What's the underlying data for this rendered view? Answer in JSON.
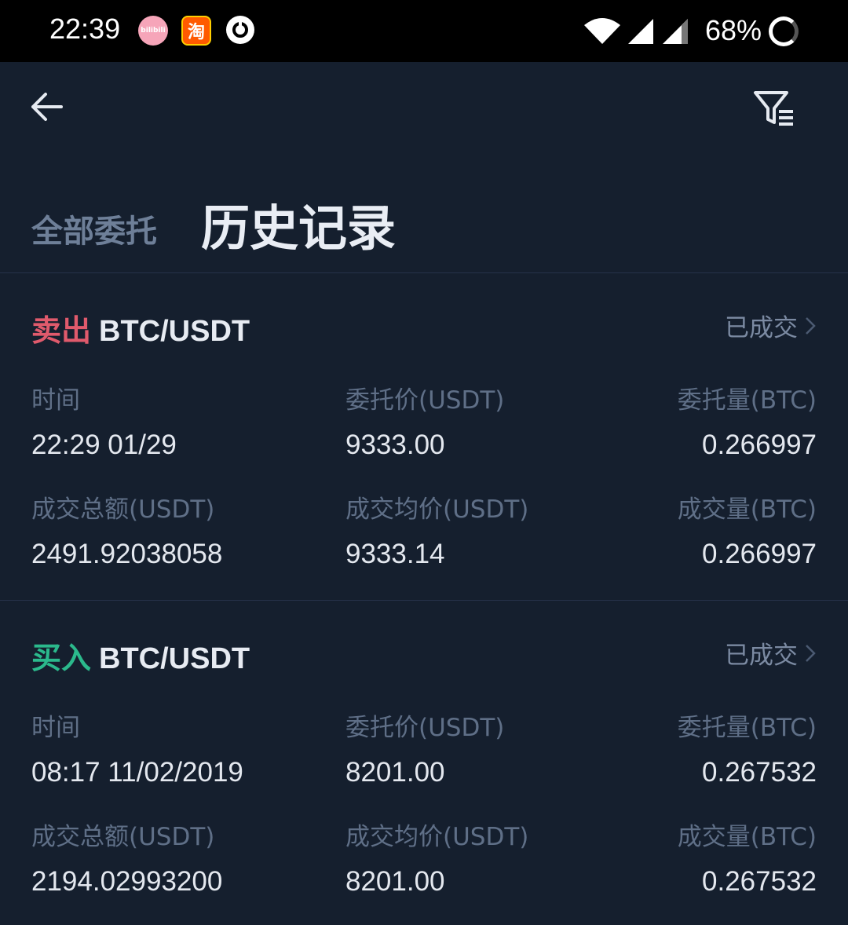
{
  "status_bar": {
    "time": "22:39",
    "battery": "68%",
    "apps": [
      "bilibili",
      "淘"
    ]
  },
  "header": {
    "back_icon": "arrow-left-icon",
    "filter_icon": "filter-icon"
  },
  "tabs": [
    {
      "label": "全部委托",
      "active": false
    },
    {
      "label": "历史记录",
      "active": true
    }
  ],
  "orders": [
    {
      "side": "卖出",
      "pair": "BTC/USDT",
      "status": "已成交",
      "side_color": "#e05a6c",
      "labels": [
        "时间",
        "委托价(USDT)",
        "委托量(BTC)",
        "成交总额(USDT)",
        "成交均价(USDT)",
        "成交量(BTC)"
      ],
      "values": [
        "22:29 01/29",
        "9333.00",
        "0.266997",
        "2491.92038058",
        "9333.14",
        "0.266997"
      ]
    },
    {
      "side": "买入",
      "pair": "BTC/USDT",
      "status": "已成交",
      "side_color": "#2bb98c",
      "labels": [
        "时间",
        "委托价(USDT)",
        "委托量(BTC)",
        "成交总额(USDT)",
        "成交均价(USDT)",
        "成交量(BTC)"
      ],
      "values": [
        "08:17 11/02/2019",
        "8201.00",
        "0.267532",
        "2194.02993200",
        "8201.00",
        "0.267532"
      ]
    }
  ]
}
